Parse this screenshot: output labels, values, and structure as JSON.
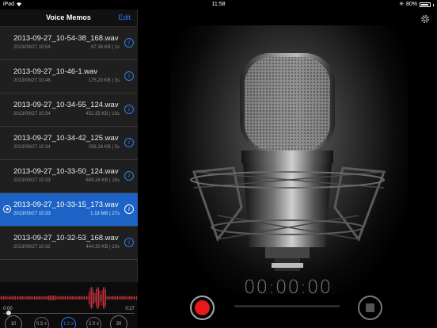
{
  "status_bar": {
    "device": "iPad",
    "time": "11:58",
    "battery": "80%"
  },
  "nav": {
    "title": "Voice Memos",
    "edit_label": "Edit"
  },
  "recordings": [
    {
      "name": "2013-09-27_10-54-38_168.wav",
      "date": "2013/09/27 10:54",
      "meta": "67.36 KB | 1s",
      "selected": false
    },
    {
      "name": "2013-09-27_10-46-1.wav",
      "date": "2013/09/27 10:46",
      "meta": "175.20 KB | 3s",
      "selected": false
    },
    {
      "name": "2013-09-27_10-34-55_124.wav",
      "date": "2013/09/27 10:34",
      "meta": "452.35 KB | 10s",
      "selected": false
    },
    {
      "name": "2013-09-27_10-34-42_125.wav",
      "date": "2013/09/27 10:34",
      "meta": "256.28 KB | 5s",
      "selected": false
    },
    {
      "name": "2013-09-27_10-33-50_124.wav",
      "date": "2013/09/27 10:33",
      "meta": "659.24 KB | 15s",
      "selected": false
    },
    {
      "name": "2013-09-27_10-33-15_173.wav",
      "date": "2013/09/27 10:33",
      "meta": "1.18 MB | 27s",
      "selected": true
    },
    {
      "name": "2013-09-27_10-32-53_168.wav",
      "date": "2013/09/27 10:32",
      "meta": "444.30 KB | 10s",
      "selected": false
    }
  ],
  "player": {
    "time_start": "0:00",
    "time_end": "0:27",
    "skip_back_label": "10",
    "skip_forward_label": "30",
    "speeds": [
      "0.5 x",
      "1.0 x",
      "2.0 x"
    ],
    "active_speed": "1.0 x"
  },
  "recorder": {
    "timer": "00:00:00"
  },
  "colors": {
    "accent": "#2f7bf0",
    "selected_row": "#1d63c6",
    "record": "#e8181b"
  },
  "icons": [
    "wifi-icon",
    "bluetooth-icon",
    "battery-icon",
    "info-icon",
    "play-icon",
    "gear-icon",
    "microphone-icon",
    "record-icon",
    "stop-icon"
  ]
}
